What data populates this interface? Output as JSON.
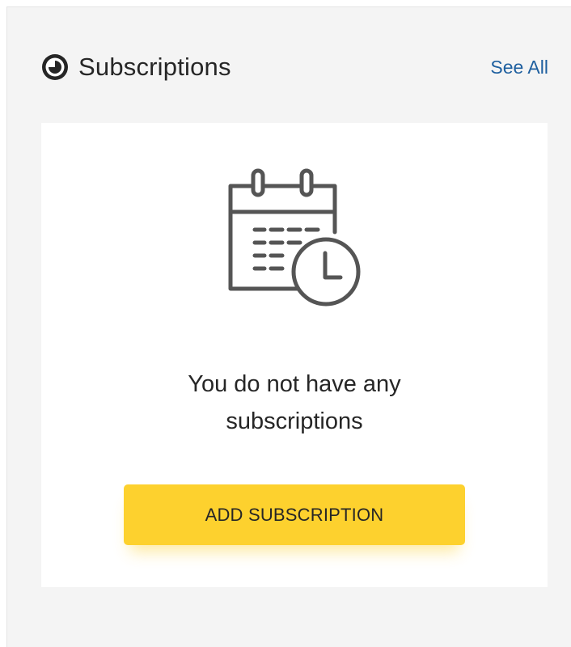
{
  "header": {
    "title": "Subscriptions",
    "see_all_label": "See All",
    "icon": "clock-icon"
  },
  "empty_state": {
    "illustration_icon": "calendar-clock-icon",
    "message": "You do not have any subscriptions"
  },
  "actions": {
    "add_subscription_label": "ADD SUBSCRIPTION"
  },
  "colors": {
    "panel_background": "#f4f4f4",
    "card_background": "#ffffff",
    "link": "#1e5f9f",
    "button": "#fdd12e",
    "text": "#262626",
    "icon_stroke": "#555555"
  }
}
